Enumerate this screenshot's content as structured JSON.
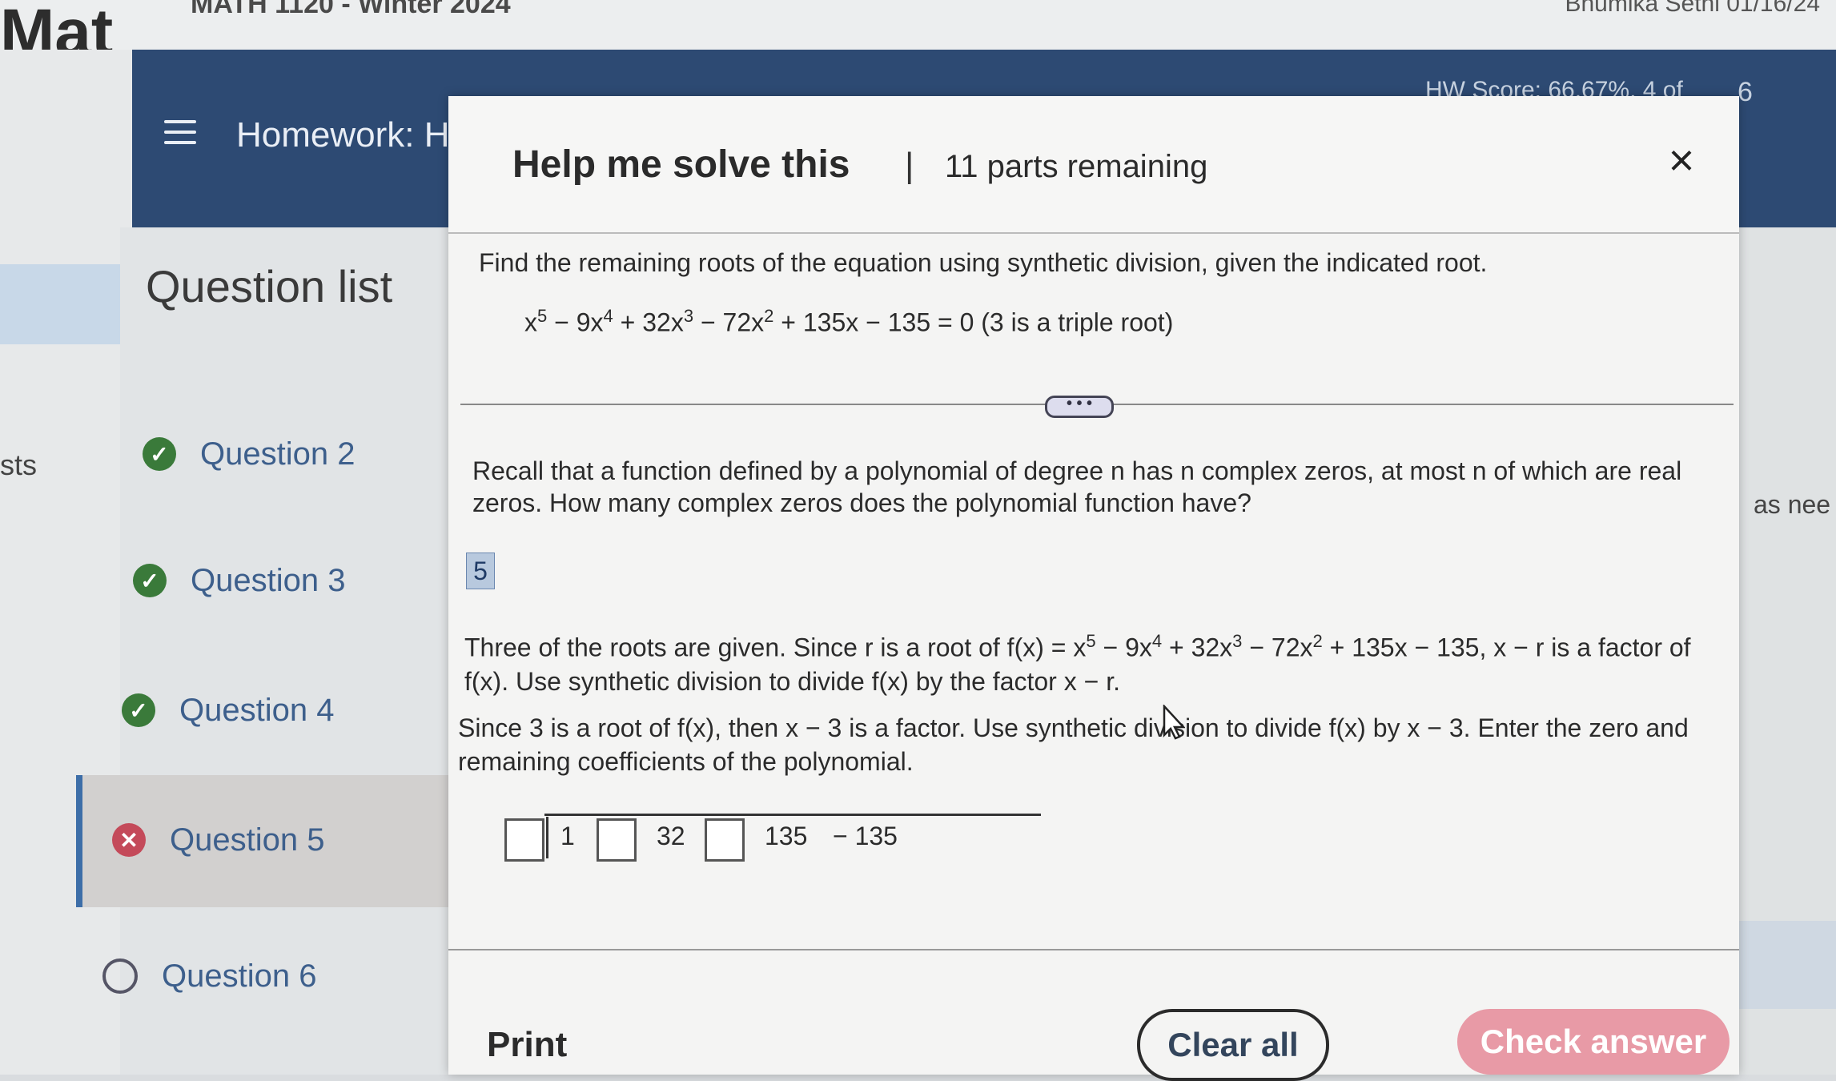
{
  "app": {
    "logo_text": "Mat",
    "course": "MATH 1120 - Winter 2024",
    "user": "Bhumika Sethi  01/16/24"
  },
  "header": {
    "homework_label": "Homework: HV",
    "score": "HW Score: 66.67%,  4 of",
    "page_count": "6"
  },
  "sidebar": {
    "title": "Question list",
    "left_fragment": "sts",
    "items": [
      {
        "label": "Question 2",
        "status": "correct"
      },
      {
        "label": "Question 3",
        "status": "correct"
      },
      {
        "label": "Question 4",
        "status": "correct"
      },
      {
        "label": "Question 5",
        "status": "incorrect"
      },
      {
        "label": "Question 6",
        "status": "unanswered"
      }
    ]
  },
  "modal": {
    "title": "Help me solve this",
    "separator": "|",
    "parts_remaining": "11 parts remaining",
    "close_symbol": "×",
    "problem": "Find the remaining roots of the equation using synthetic division, given the indicated root.",
    "equation_parts": [
      "x",
      "5",
      " − 9x",
      "4",
      " + 32x",
      "3",
      " − 72x",
      "2",
      " + 135x − 135 = 0 (3 is a triple root)"
    ],
    "recall": "Recall that a function defined by a polynomial of degree n has n complex   zeros, at most n of which are real zeros. How many complex zeros does the polynomial function have?",
    "answer_value": "5",
    "three_roots_parts": [
      "Three of the roots are given. Since r is a root of f(x) = x",
      "5",
      " − 9x",
      "4",
      " + 32x",
      "3",
      " − 72x",
      "2",
      " + 135x − 135, x − r is a factor of f(x). Use synthetic division to divide f(x) by the factor x − r."
    ],
    "since_three": "Since 3 is a root of f(x), then x − 3 is a factor. Use synthetic division to divide f(x) by x − 3. Enter the zero and remaining coefficients of the polynomial.",
    "synthetic_values": [
      "1",
      "32",
      "135",
      "− 135"
    ],
    "buttons": {
      "print": "Print",
      "clear": "Clear all",
      "check": "Check answer"
    },
    "drag_dots": "• • •"
  },
  "right_edge": {
    "fragment": "as nee"
  },
  "colors": {
    "header_blue": "#2d4a73",
    "correct_green": "#3a7a3a",
    "incorrect_red": "#c44a5a",
    "check_pink": "#e89aa6",
    "link_blue": "#3d5f8c"
  }
}
